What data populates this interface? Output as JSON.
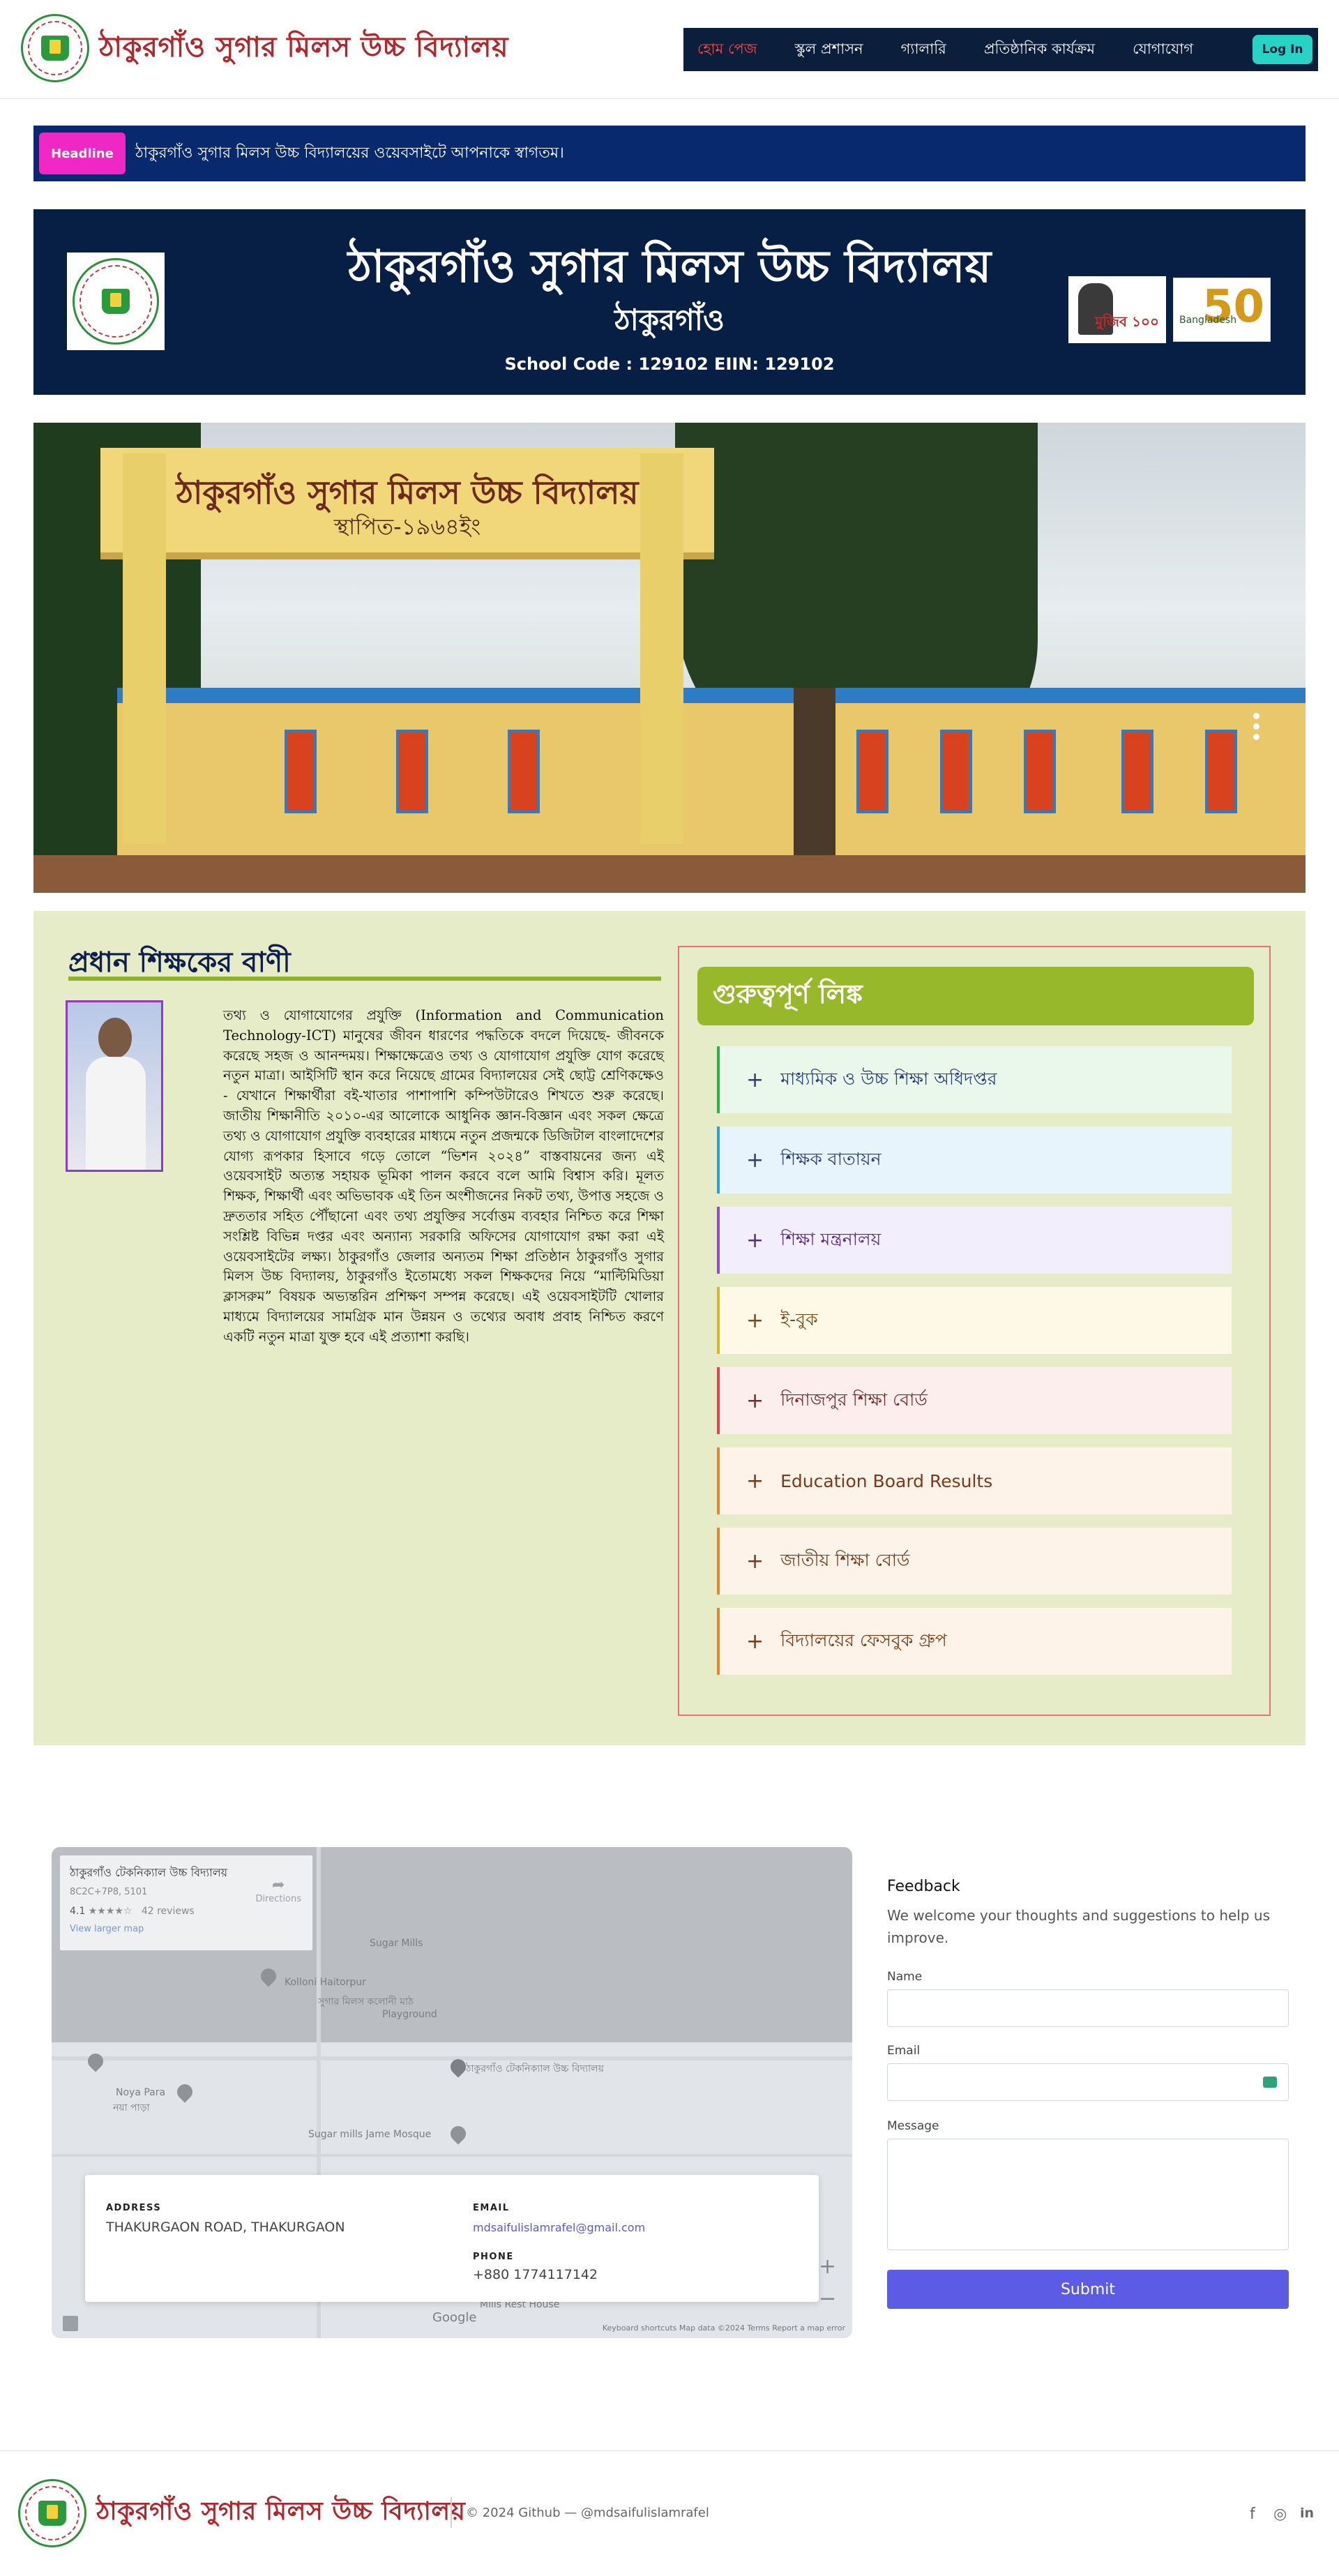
{
  "header": {
    "brand_title": "ঠাকুরগাঁও সুগার মিলস উচ্চ বিদ্যালয়",
    "nav": [
      {
        "label": "হোম পেজ",
        "active": true
      },
      {
        "label": "স্কুল প্রশাসন",
        "active": false
      },
      {
        "label": "গ্যালারি",
        "active": false
      },
      {
        "label": "প্রতিষ্ঠানিক কার্যক্রম",
        "active": false
      },
      {
        "label": "যোগাযোগ",
        "active": false
      }
    ],
    "login_label": "Log In"
  },
  "headline": {
    "badge": "Headline",
    "text": "ঠাকুরগাঁও সুগার মিলস উচ্চ বিদ্যালয়ের ওয়েবসাইটে আপনাকে স্বাগতম।"
  },
  "banner": {
    "title": "ঠাকুরগাঁও সুগার মিলস উচ্চ বিদ্যালয়",
    "subtitle": "ঠাকুরগাঁও",
    "code": "School Code : 129102 EIIN: 129102",
    "badge_left": "মুজিব ১০০",
    "badge_right_num": "50",
    "badge_right_text": "Bangladesh"
  },
  "hero": {
    "arch_line1": "ঠাকুরগাঁও সুগার মিলস উচ্চ বিদ্যালয়",
    "arch_line2": "স্থাপিত-১৯৬৪ইং"
  },
  "message": {
    "title": "প্রধান শিক্ষকের বাণী",
    "body": "তথ্য ও যোগাযোগের প্রযুক্তি (Information and Communication Technology-ICT) মানুষের জীবন ধারণের পদ্ধতিকে বদলে দিয়েছে- জীবনকে করেছে সহজ ও আনন্দময়। শিক্ষাক্ষেত্রেও তথ্য ও যোগাযোগ প্রযুক্তি যোগ করেছে নতুন মাত্রা। আইসিটি স্থান করে নিয়েছে গ্রামের বিদ্যালয়ের সেই ছোট্ট শ্রেণিকক্ষেও - যেখানে শিক্ষার্থীরা বই-খাতার পাশাপাশি কম্পিউটারেও শিখতে শুরু করেছে। জাতীয় শিক্ষানীতি ২০১০-এর আলোকে আধুনিক জ্ঞান-বিজ্ঞান এবং সকল ক্ষেত্রে তথ্য ও যোগাযোগ প্রযুক্তি ব্যবহারের মাধ্যমে নতুন প্রজন্মকে ডিজিটাল বাংলাদেশের যোগ্য রূপকার হিসাবে গড়ে তোলে “ভিশন ২০২৪” বাস্তবায়নের জন্য এই ওয়েবসাইট অত্যন্ত সহায়ক ভূমিকা পালন করবে বলে আমি বিশ্বাস করি। মূলত শিক্ষক, শিক্ষার্থী এবং অভিভাবক এই তিন অংশীজনের নিকট তথ্য, উপাত্ত সহজে ও দ্রুততার সহিত পৌঁছানো এবং তথ্য প্রযুক্তির সর্বোত্তম ব্যবহার নিশ্চিত করে শিক্ষা সংশ্লিষ্ট বিভিন্ন দপ্তর এবং অন্যান্য সরকারি অফিসের যোগাযোগ রক্ষা করা এই ওয়েবসাইটের লক্ষ্য। ঠাকুরগাঁও জেলার অন্যতম শিক্ষা প্রতিষ্ঠান ঠাকুরগাঁও সুগার মিলস উচ্চ বিদ্যালয়, ঠাকুরগাঁও ইতোমধ্যে সকল শিক্ষকদের নিয়ে “মাল্টিমিডিয়া ক্লাসরুম” বিষয়ক অভ্যন্তরিন প্রশিক্ষণ সম্পন্ন করেছে। এই ওয়েবসাইটটি খোলার মাধ্যমে বিদ্যালয়ের সামগ্রিক মান উন্নয়ন ও তথ্যের অবাধ প্রবাহ নিশ্চিত করণে একটি নতুন মাত্রা যুক্ত হবে এই প্রত্যাশা করছি।"
  },
  "links": {
    "title": "গুরুত্বপূর্ণ লিঙ্ক",
    "items": [
      {
        "label": "মাধ্যমিক ও উচ্চ শিক্ষা অধিদপ্তর",
        "bg": "#e9f8ea",
        "border": "#2fb14a",
        "color": "#2c3e7a"
      },
      {
        "label": "শিক্ষক বাতায়ন",
        "bg": "#e8f4fb",
        "border": "#2a9ed6",
        "color": "#2c3e7a"
      },
      {
        "label": "শিক্ষা মন্ত্রনালয়",
        "bg": "#f3eefb",
        "border": "#8a4ec9",
        "color": "#5a2a8a"
      },
      {
        "label": "ই-বুক",
        "bg": "#fdf9e6",
        "border": "#d6b72a",
        "color": "#7a4a1a"
      },
      {
        "label": "দিনাজপুর শিক্ষা বোর্ড",
        "bg": "#fdeeee",
        "border": "#d64a4a",
        "color": "#7a2a2a"
      },
      {
        "label": "Education Board Results",
        "bg": "#fdf3e8",
        "border": "#e0882a",
        "color": "#7a3a1a"
      },
      {
        "label": "জাতীয় শিক্ষা বোর্ড",
        "bg": "#fdf3e8",
        "border": "#e0882a",
        "color": "#7a3a1a"
      },
      {
        "label": "বিদ্যালয়ের ফেসবুক গ্রুপ",
        "bg": "#fdf3e8",
        "border": "#e0882a",
        "color": "#7a3a1a"
      }
    ],
    "plus": "+"
  },
  "map": {
    "place_name": "ঠাকুরগাঁও টেকনিক্যাল উচ্চ বিদ্যালয়",
    "plus_code": "8C2C+7P8, 5101",
    "rating": "4.1",
    "stars": "★★★★☆",
    "reviews": "42 reviews",
    "larger_map": "View larger map",
    "directions": "Directions",
    "labels": [
      "Kolloni Haitorpur",
      "Sugar Mills",
      "সুগার মিলস কলোনী মাঠ",
      "Playground",
      "Noya Para",
      "নয়া পাড়া",
      "ঠাকুরগাঁও টেকনিক্যাল উচ্চ বিদ্যালয়",
      "Sugar mills Jame Mosque",
      "Mills Rest House",
      "Google"
    ],
    "footer_links": "Keyboard shortcuts   Map data ©2024   Terms   Report a map error"
  },
  "contact": {
    "address_label": "ADDRESS",
    "address": "THAKURGAON ROAD, THAKURGAON",
    "email_label": "EMAIL",
    "email": "mdsaifulislamrafel@gmail.com",
    "phone_label": "PHONE",
    "phone": "+880 1774117142"
  },
  "feedback": {
    "title": "Feedback",
    "description": "We welcome your thoughts and suggestions to help us improve.",
    "name_label": "Name",
    "email_label": "Email",
    "message_label": "Message",
    "submit_label": "Submit"
  },
  "footer": {
    "brand_title": "ঠাকুরগাঁও সুগার মিলস উচ্চ বিদ্যালয়",
    "copyright": "© 2024 Github — @mdsaifulislamrafel",
    "social": [
      {
        "name": "facebook-icon",
        "glyph": "f"
      },
      {
        "name": "instagram-icon",
        "glyph": "◎"
      },
      {
        "name": "linkedin-icon",
        "glyph": "in"
      }
    ]
  }
}
